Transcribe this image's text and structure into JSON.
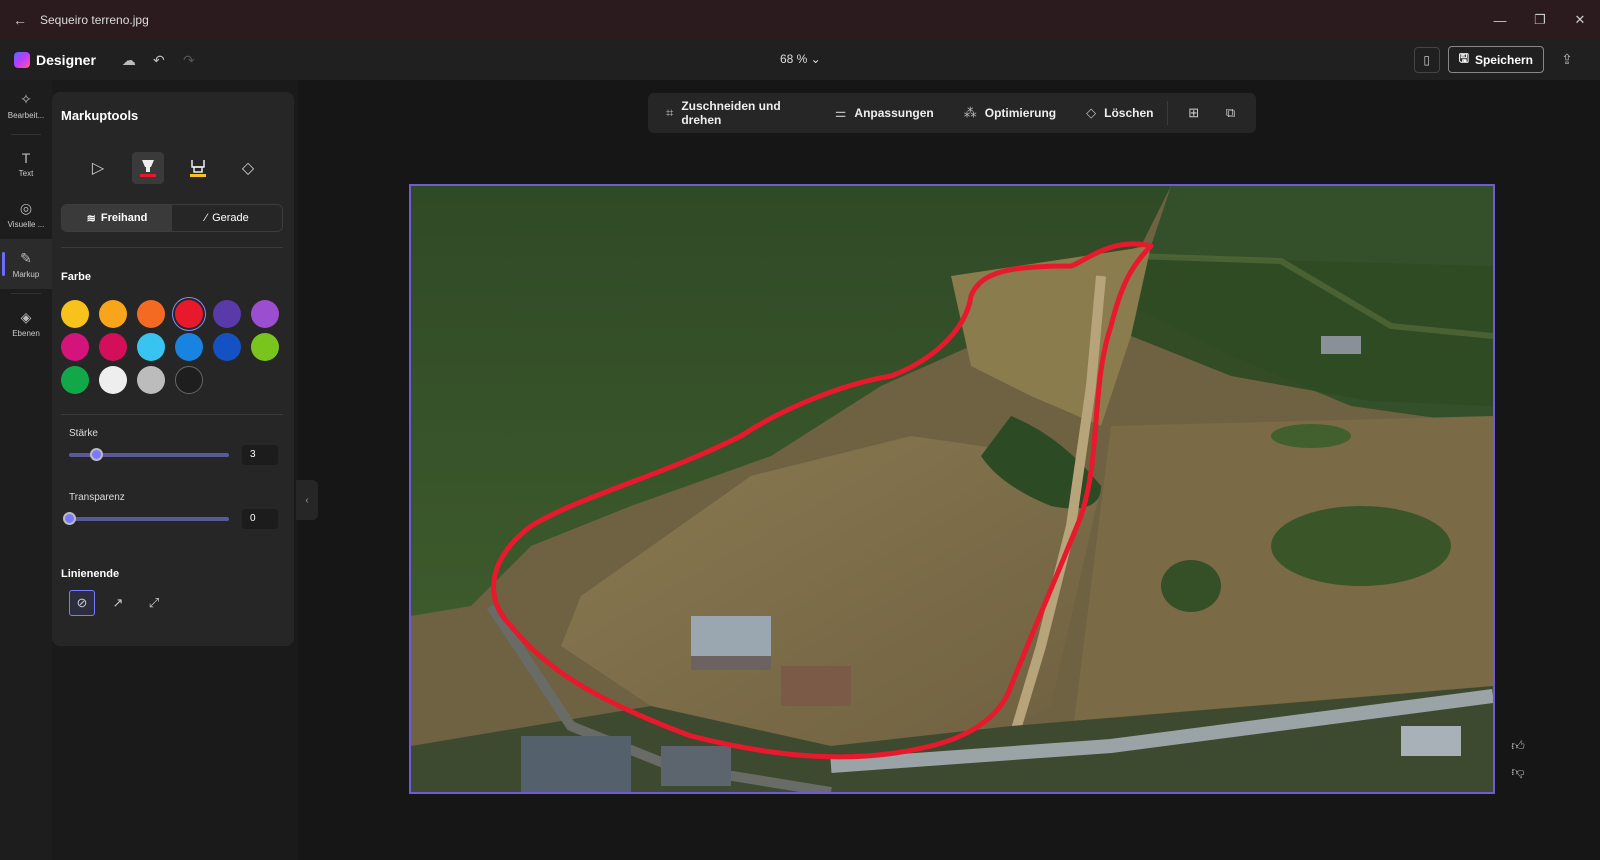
{
  "window": {
    "title": "Sequeiro terreno.jpg",
    "back_icon": "back-arrow-icon"
  },
  "app": {
    "name": "Designer",
    "zoom": "68 % ⌄",
    "save_label": "Speichern"
  },
  "rail": [
    {
      "label": "Bearbeit...",
      "icon": "sparkle-edit-icon"
    },
    {
      "label": "Text",
      "icon": "text-icon"
    },
    {
      "label": "Visuelle ...",
      "icon": "shapes-icon"
    },
    {
      "label": "Markup",
      "icon": "pen-icon",
      "active": true
    },
    {
      "label": "Ebenen",
      "icon": "layers-icon"
    }
  ],
  "panel": {
    "title": "Markuptools",
    "mode_freehand": "Freihand",
    "mode_straight": "Gerade",
    "color_label": "Farbe",
    "colors": [
      "#f8c21c",
      "#f8a51c",
      "#f46a23",
      "#e8192c",
      "#5a3aa8",
      "#9b4fd0",
      "#d4147a",
      "#d40f5a",
      "#38c3f0",
      "#1883e0",
      "#1452c4",
      "#7ac41e",
      "#12a84a",
      "#eeeeee",
      "#bcbcbc",
      "#1e1e1e"
    ],
    "selected_color": "#e8192c",
    "strength_label": "Stärke",
    "strength_value": "3",
    "strength_fraction": 0.17,
    "transparency_label": "Transparenz",
    "transparency_value": "0",
    "transparency_fraction": 0,
    "line_end_label": "Linienende"
  },
  "toolbar": {
    "crop": "Zuschneiden und drehen",
    "adjust": "Anpassungen",
    "optimize": "Optimierung",
    "erase": "Löschen"
  },
  "colors": {
    "accent": "#6f5ad8",
    "markup_stroke": "#e8192c"
  }
}
